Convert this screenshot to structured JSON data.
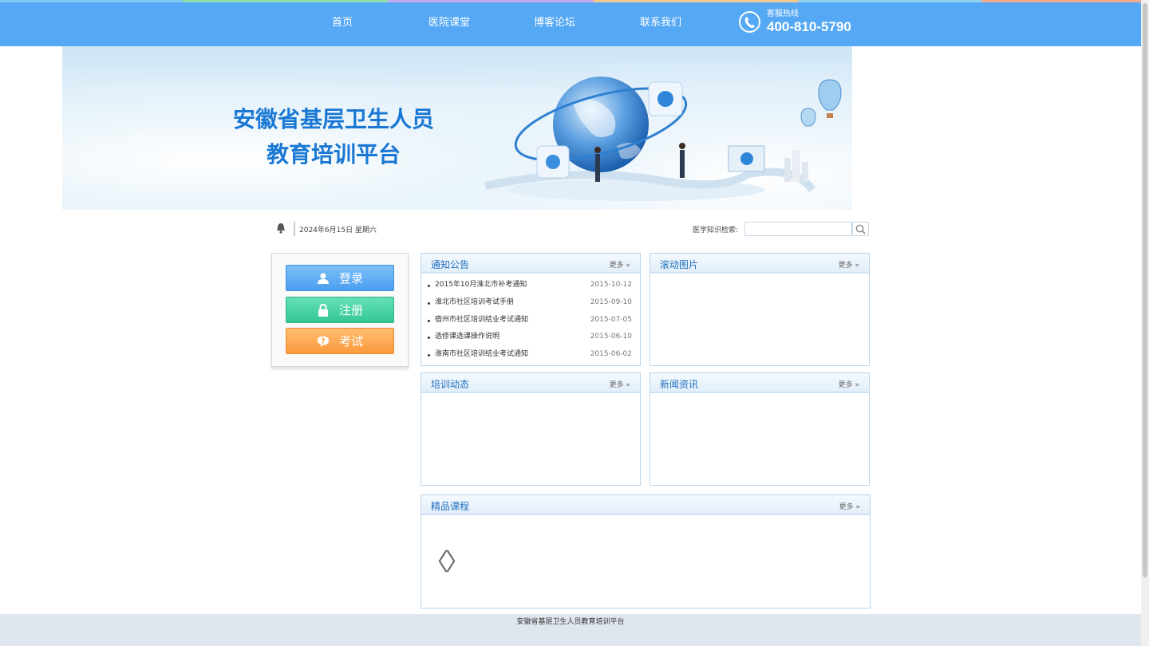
{
  "nav": {
    "items": [
      {
        "label": "首页"
      },
      {
        "label": "医院课堂"
      },
      {
        "label": "博客论坛"
      },
      {
        "label": "联系我们"
      }
    ],
    "hotline_label": "客服热线",
    "hotline_number": "400-810-5790"
  },
  "banner": {
    "title_line1": "安徽省基层卫生人员",
    "title_line2": "教育培训平台"
  },
  "toolbar": {
    "date": "2024年6月15日 星期六",
    "search_label": "医学知识检索:",
    "search_value": "",
    "search_placeholder": ""
  },
  "login_box": {
    "login_label": "登录",
    "register_label": "注册",
    "exam_label": "考试"
  },
  "panels": {
    "notice": {
      "title": "通知公告",
      "more": "更多 »",
      "items": [
        {
          "title": "2015年10月淮北市补考通知",
          "date": "2015-10-12"
        },
        {
          "title": "淮北市社区培训考试手册",
          "date": "2015-09-10"
        },
        {
          "title": "宿州市社区培训结业考试通知",
          "date": "2015-07-05"
        },
        {
          "title": "选修课选课操作说明",
          "date": "2015-06-10"
        },
        {
          "title": "淮南市社区培训结业考试通知",
          "date": "2015-06-02"
        }
      ]
    },
    "slides": {
      "title": "滚动图片",
      "more": "更多 »"
    },
    "training": {
      "title": "培训动态",
      "more": "更多 »"
    },
    "news": {
      "title": "新闻资讯",
      "more": "更多 »"
    },
    "courses": {
      "title": "精品课程",
      "more": "更多 »",
      "prev": "〈",
      "next": "〉"
    }
  },
  "footer": {
    "text": "安徽省基层卫生人员教育培训平台"
  },
  "colors": {
    "nav_bg": "#55a8f4",
    "accent": "#1f6fbf",
    "login": "#4a9ef0",
    "register": "#34c894",
    "exam": "#fb9a3c"
  },
  "icons": [
    "phone-icon",
    "bell-icon",
    "search-icon",
    "user-icon",
    "lock-icon",
    "question-icon"
  ]
}
